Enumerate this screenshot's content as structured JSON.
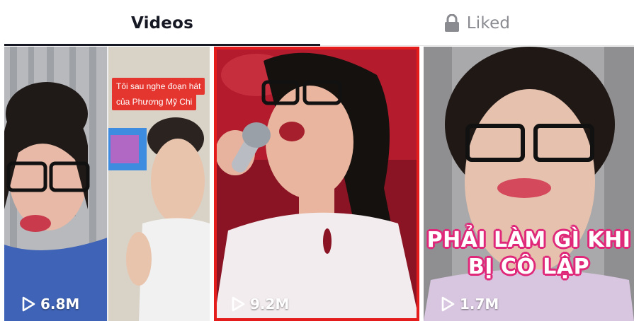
{
  "tabs": {
    "videos_label": "Videos",
    "liked_label": "Liked",
    "liked_icon": "lock-icon",
    "active": "Videos"
  },
  "videos": [
    {
      "views": "6.8M",
      "overlay_text_line1": "Tôi sau nghe đoạn hát",
      "overlay_text_line2": "của Phương Mỹ Chi",
      "selected": false
    },
    {
      "views": "9.2M",
      "selected": true
    },
    {
      "views": "1.7M",
      "caption_line1": "PHẢI LÀM GÌ KHI",
      "caption_line2": "BỊ CÔ LẬP",
      "selected": false
    }
  ],
  "colors": {
    "text_primary": "#161823",
    "text_muted": "#8a8b91",
    "selected_border": "#e51c1c",
    "caption_pink": "#e0287a",
    "overlay_red": "#e4362f"
  }
}
